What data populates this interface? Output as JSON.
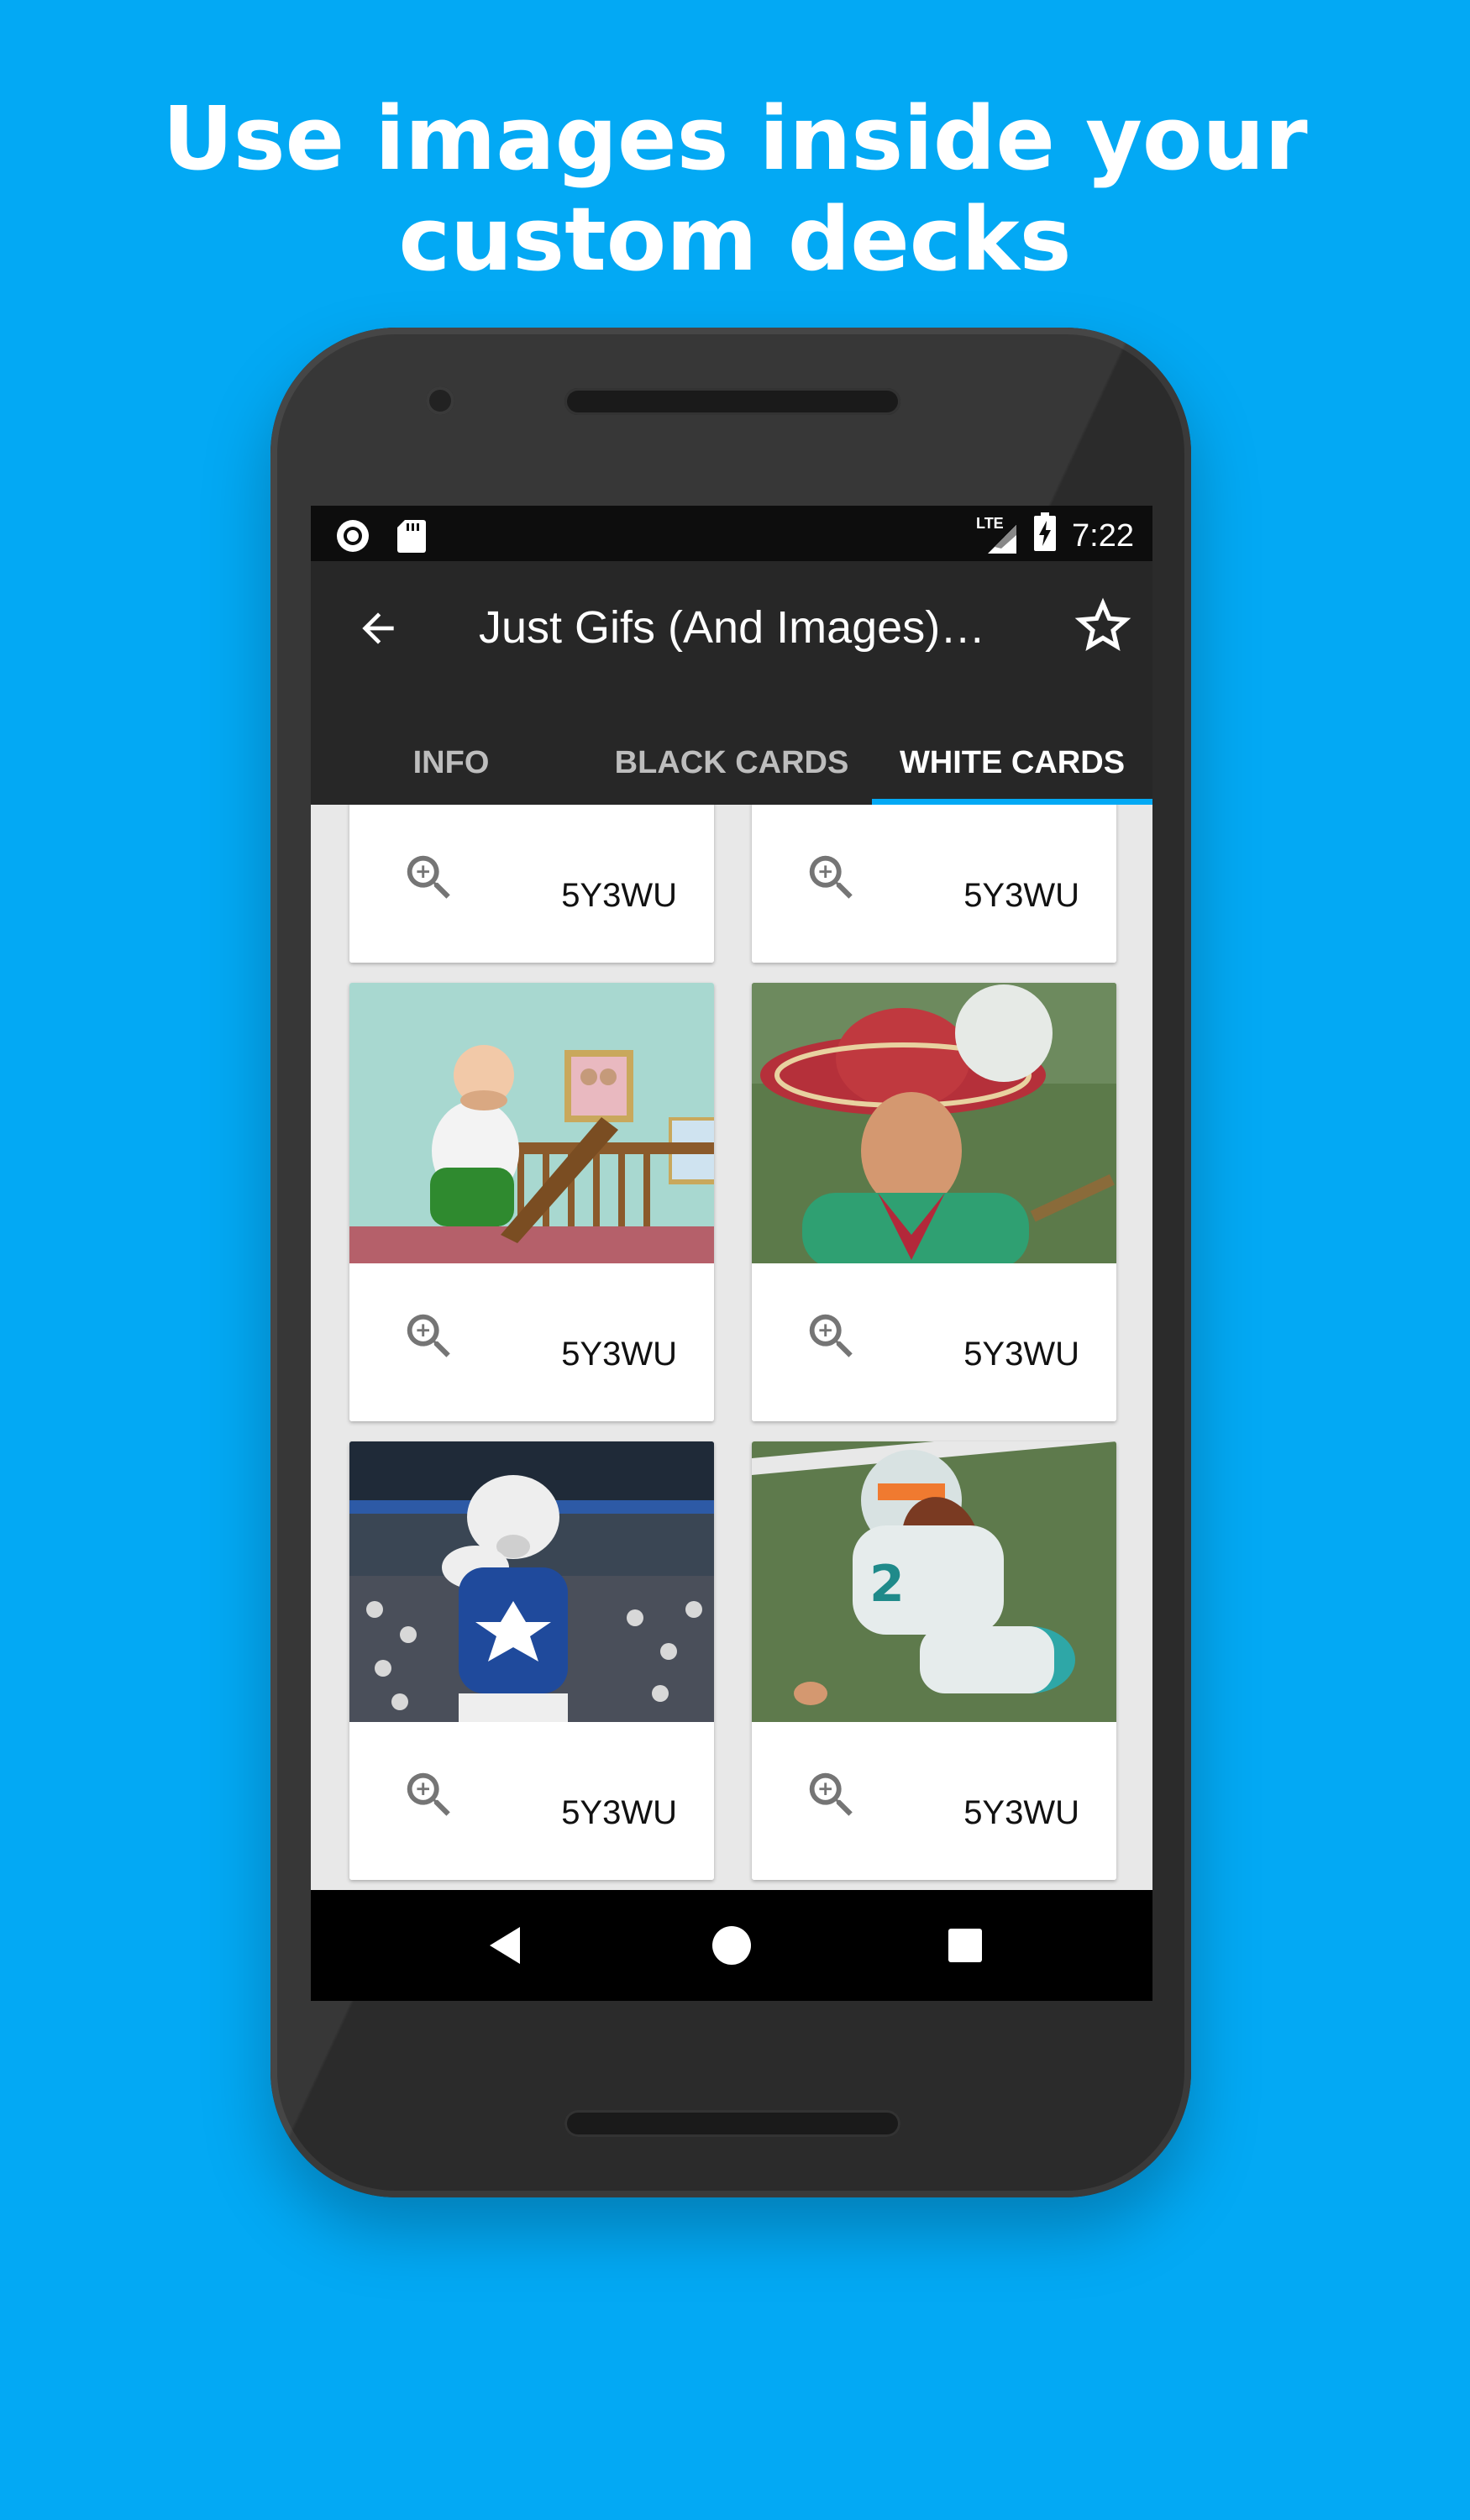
{
  "promo": {
    "headline_line1": "Use images inside your",
    "headline_line2": "custom decks"
  },
  "status_bar": {
    "network": "LTE",
    "time": "7:22"
  },
  "app_bar": {
    "title": "Just Gifs (And Images)…",
    "back_icon": "arrow-back-icon",
    "favorite_icon": "star-outline-icon"
  },
  "tabs": [
    {
      "label": "INFO",
      "active": false
    },
    {
      "label": "BLACK CARDS",
      "active": false
    },
    {
      "label": "WHITE CARDS",
      "active": true
    }
  ],
  "cards": [
    {
      "code": "5Y3WU",
      "image": "none"
    },
    {
      "code": "5Y3WU",
      "image": "none"
    },
    {
      "code": "5Y3WU",
      "image": "cartoon-man-at-staircase"
    },
    {
      "code": "5Y3WU",
      "image": "man-in-sombrero-hit-by-ball"
    },
    {
      "code": "5Y3WU",
      "image": "bear-mascot-in-stadium"
    },
    {
      "code": "5Y3WU",
      "image": "football-player-hit-by-ball"
    }
  ],
  "colors": {
    "background": "#03a9f4",
    "app_bar": "#272727",
    "tab_indicator": "#03a9f4"
  }
}
